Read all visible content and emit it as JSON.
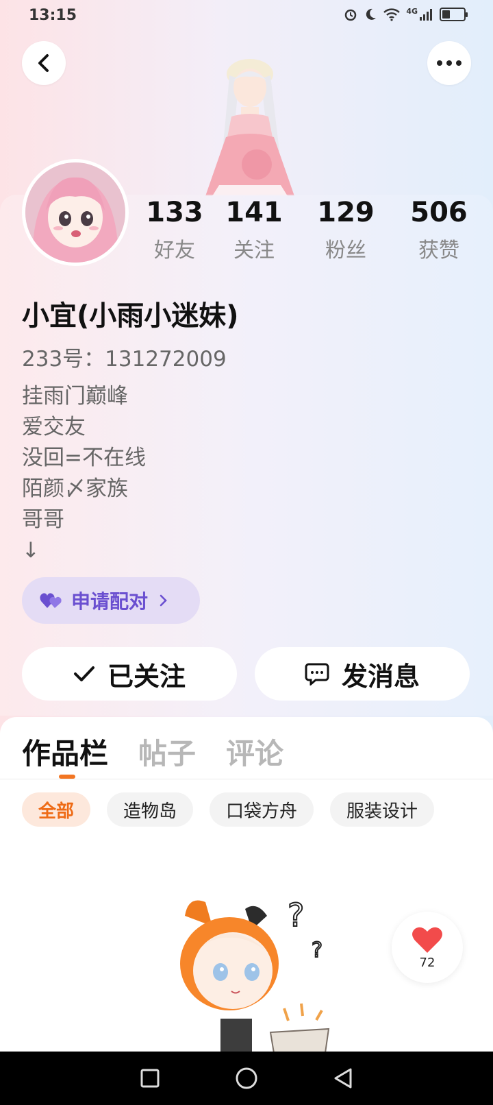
{
  "status_bar": {
    "time": "13:15",
    "network": "4G",
    "battery_level": 0.35,
    "icons": [
      "alarm-icon",
      "moon-icon",
      "wifi-icon",
      "signal-icon",
      "battery-icon"
    ]
  },
  "header": {
    "back_icon": "chevron-left-icon",
    "more_icon": "more-dots-icon"
  },
  "profile": {
    "name": "小宜(小雨小迷妹)",
    "id_line": "233号：131272009",
    "bio": [
      "挂雨门巅峰",
      "爱交友",
      "没回=不在线",
      "陌颜〆家族",
      "哥哥",
      "↓"
    ],
    "stats": [
      {
        "value": "133",
        "label": "好友"
      },
      {
        "value": "141",
        "label": "关注"
      },
      {
        "value": "129",
        "label": "粉丝"
      },
      {
        "value": "506",
        "label": "获赞"
      }
    ],
    "pair_button": "申请配对",
    "follow_button": "已关注",
    "message_button": "发消息"
  },
  "tabs": [
    {
      "label": "作品栏",
      "active": true
    },
    {
      "label": "帖子",
      "active": false
    },
    {
      "label": "评论",
      "active": false
    }
  ],
  "chips": [
    {
      "label": "全部",
      "active": true
    },
    {
      "label": "造物岛",
      "active": false
    },
    {
      "label": "口袋方舟",
      "active": false
    },
    {
      "label": "服装设计",
      "active": false
    }
  ],
  "like_float": {
    "count": "72"
  },
  "colors": {
    "accent": "#f27522",
    "pair_purple": "#6a4fd0",
    "heart_red": "#f24b4b"
  }
}
